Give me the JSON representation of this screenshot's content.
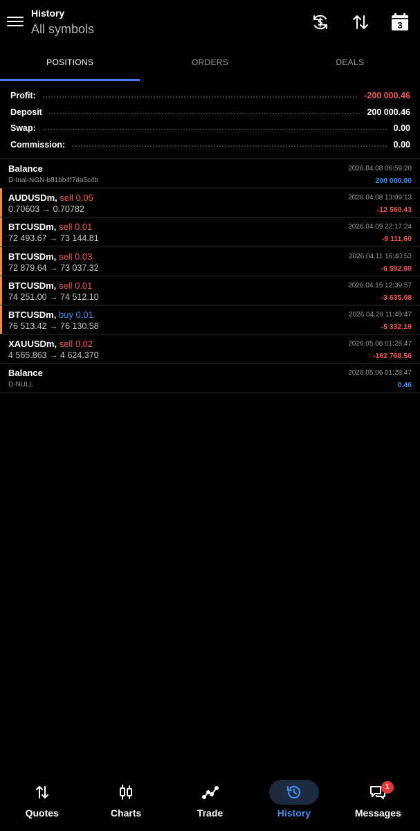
{
  "header": {
    "title": "History",
    "subtitle": "All symbols",
    "calendar_day": "3"
  },
  "tabs": [
    {
      "label": "POSITIONS",
      "active": true
    },
    {
      "label": "ORDERS",
      "active": false
    },
    {
      "label": "DEALS",
      "active": false
    }
  ],
  "summary": {
    "profit_label": "Profit:",
    "profit_value": "-200 000.46",
    "deposit_label": "Deposit",
    "deposit_value": "200 000.46",
    "swap_label": "Swap:",
    "swap_value": "0.00",
    "commission_label": "Commission:",
    "commission_value": "0.00"
  },
  "rows": [
    {
      "type": "balance",
      "title": "Balance",
      "sub": "D-trial-NGN-b81bb4f7da5c4b",
      "date": "2026.04.08 06:59:20",
      "amount": "200 000.00",
      "amount_color": "blue"
    },
    {
      "type": "position",
      "symbol": "AUDUSDm,",
      "side": "sell 0.05",
      "side_type": "sell",
      "prices": "0.70603 → 0.70782",
      "date": "2026.04.08 13:09:13",
      "amount": "-12 560.43",
      "amount_color": "neg"
    },
    {
      "type": "position",
      "symbol": "BTCUSDm,",
      "side": "sell 0.01",
      "side_type": "sell",
      "prices": "72 493.67 → 73 144.81",
      "date": "2026.04.09 22:17:24",
      "amount": "-9 111.60",
      "amount_color": "neg"
    },
    {
      "type": "position",
      "symbol": "BTCUSDm,",
      "side": "sell 0.03",
      "side_type": "sell",
      "prices": "72 879.64 → 73 037.32",
      "date": "2026.04.11 16:40:53",
      "amount": "-6 592.60",
      "amount_color": "neg"
    },
    {
      "type": "position",
      "symbol": "BTCUSDm,",
      "side": "sell 0.01",
      "side_type": "sell",
      "prices": "74 251.00 → 74 512.10",
      "date": "2026.04.15 12:39:57",
      "amount": "-3 635.08",
      "amount_color": "neg"
    },
    {
      "type": "position",
      "symbol": "BTCUSDm,",
      "side": "buy 0.01",
      "side_type": "buy",
      "prices": "76 513.42 → 76 130.58",
      "date": "2026.04.28 11:49:47",
      "amount": "-5 332.19",
      "amount_color": "neg"
    },
    {
      "type": "position",
      "symbol": "XAUUSDm,",
      "side": "sell 0.02",
      "side_type": "sell",
      "prices": "4 565.863 → 4 624.370",
      "date": "2026.05.06 01:28:47",
      "amount": "-162 768.56",
      "amount_color": "neg"
    },
    {
      "type": "balance",
      "title": "Balance",
      "sub": "D-NULL",
      "date": "2026.05.06 01:28:47",
      "amount": "0.46",
      "amount_color": "blue"
    }
  ],
  "nav": [
    {
      "label": "Quotes",
      "icon": "quotes-icon",
      "active": false
    },
    {
      "label": "Charts",
      "icon": "charts-icon",
      "active": false
    },
    {
      "label": "Trade",
      "icon": "trade-icon",
      "active": false
    },
    {
      "label": "History",
      "icon": "history-icon",
      "active": true
    },
    {
      "label": "Messages",
      "icon": "messages-icon",
      "active": false,
      "badge": "1"
    }
  ],
  "colors": {
    "accent": "#3e7bf0",
    "negative": "#f25555",
    "positive_blue": "#3e8cf5",
    "marker": "#f08b33",
    "background": "#000000"
  }
}
